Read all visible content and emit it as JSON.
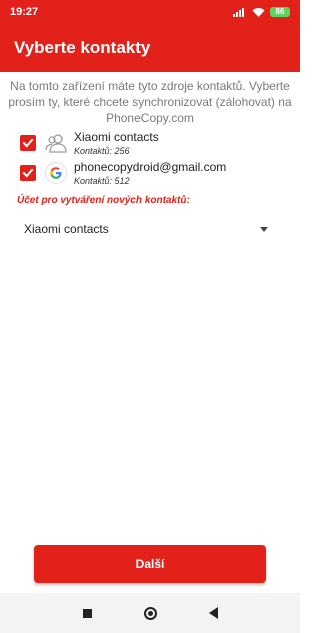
{
  "status_bar": {
    "time": "19:27",
    "battery": "86",
    "icons": [
      "signal-icon",
      "wifi-icon",
      "battery-icon"
    ]
  },
  "app_bar": {
    "title": "Vyberte kontakty"
  },
  "intro": {
    "text": "Na tomto zařízení máte tyto zdroje kontaktů. Vyberte prosím ty, které chcete synchronizovat (zálohovat) na PhoneCopy.com"
  },
  "accounts": [
    {
      "name": "Xiaomi contacts",
      "count": "Kontaktů: 256",
      "checked": true,
      "icon": "contacts-icon"
    },
    {
      "name": "phonecopydroid@gmail.com",
      "count": "Kontaktů: 512",
      "checked": true,
      "icon": "google-icon"
    }
  ],
  "new_contacts": {
    "label": "Účet pro vytváření nových kontaktů:",
    "selected": "Xiaomi contacts"
  },
  "next_button": {
    "label": "Další"
  },
  "colors": {
    "accent": "#e2221a",
    "nav_background": "#f3f3f3",
    "battery": "#5fd35f"
  }
}
